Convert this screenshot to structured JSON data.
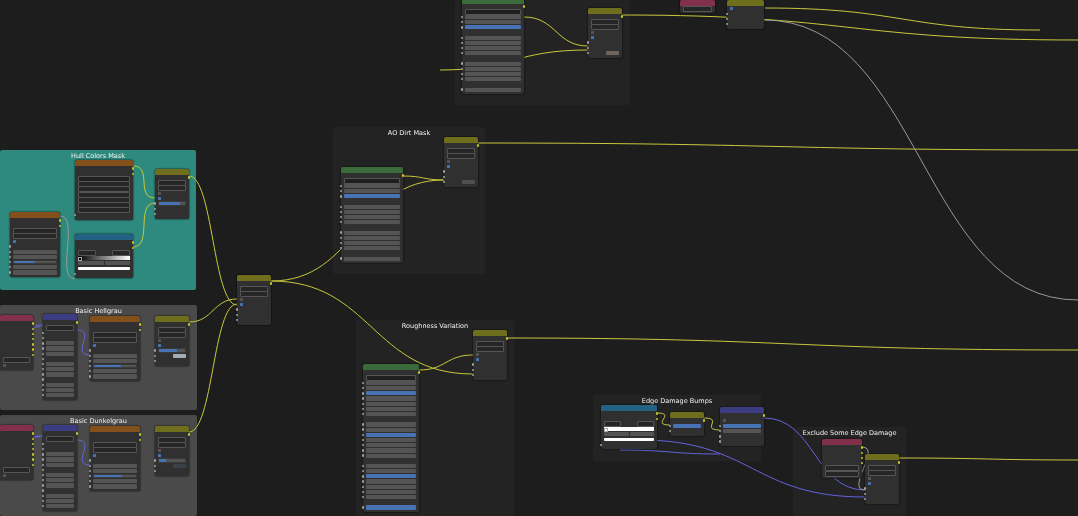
{
  "frames": [
    {
      "color": "#232323"
    },
    {
      "title": "AO Dirt Mask",
      "color": "#232323"
    },
    {
      "title": "Hull Colors Mask",
      "color": "#2e8a7e"
    },
    {
      "title": "Basic Hellgrau",
      "color": "#4a4a4a"
    },
    {
      "title": "Roughness Variation",
      "color": "#232323"
    },
    {
      "title": "Edge Damage Bumps",
      "color": "#232323"
    },
    {
      "title": "Basic Dunkelgrau",
      "color": "#4a4a4a"
    },
    {
      "title": "Exclude Some Edge Damage",
      "color": "#232323"
    }
  ],
  "nodes": [
    {
      "kind": "group",
      "rows": [
        {
          "kind": "out"
        },
        {
          "kind": "field"
        },
        {
          "kind": "value"
        },
        {
          "kind": "value"
        },
        {
          "kind": "value",
          "selected": true
        },
        {
          "kind": "sep"
        },
        {
          "kind": "value"
        },
        {
          "kind": "value"
        },
        {
          "kind": "value"
        },
        {
          "kind": "value"
        },
        {
          "kind": "sep"
        },
        {
          "kind": "value"
        },
        {
          "kind": "value"
        },
        {
          "kind": "value"
        },
        {
          "kind": "value"
        },
        {
          "kind": "sep"
        },
        {
          "kind": "value"
        }
      ]
    },
    {
      "kind": "input",
      "rows": [
        {
          "kind": "select"
        }
      ]
    },
    {
      "kind": "color",
      "rows": [
        {
          "kind": "check",
          "checked": true
        },
        {
          "kind": "in"
        },
        {
          "kind": "in"
        },
        {
          "kind": "in"
        }
      ]
    },
    {
      "kind": "color",
      "rows": [
        {
          "kind": "out"
        },
        {
          "kind": "select"
        },
        {
          "kind": "select"
        },
        {
          "kind": "check",
          "checked": false
        },
        {
          "kind": "check",
          "checked": true
        },
        {
          "kind": "in"
        },
        {
          "kind": "in"
        },
        {
          "kind": "in",
          "color": "#6e665e"
        }
      ]
    },
    {
      "kind": "color",
      "rows": [
        {
          "kind": "out"
        },
        {
          "kind": "select"
        },
        {
          "kind": "select"
        },
        {
          "kind": "check",
          "checked": false
        },
        {
          "kind": "check",
          "checked": true
        },
        {
          "kind": "in"
        },
        {
          "kind": "in"
        },
        {
          "kind": "in",
          "color": "#505050"
        }
      ]
    },
    {
      "kind": "texture",
      "rows": [
        {
          "kind": "out"
        },
        {
          "kind": "out"
        },
        {
          "kind": "field"
        },
        {
          "kind": "select"
        },
        {
          "kind": "select"
        },
        {
          "kind": "select"
        },
        {
          "kind": "select"
        },
        {
          "kind": "select"
        },
        {
          "kind": "select"
        },
        {
          "kind": "in"
        }
      ]
    },
    {
      "kind": "group",
      "rows": [
        {
          "kind": "out"
        },
        {
          "kind": "field"
        },
        {
          "kind": "value"
        },
        {
          "kind": "value"
        },
        {
          "kind": "value",
          "selected": true
        },
        {
          "kind": "sep"
        },
        {
          "kind": "value"
        },
        {
          "kind": "value"
        },
        {
          "kind": "value"
        },
        {
          "kind": "value"
        },
        {
          "kind": "sep"
        },
        {
          "kind": "value"
        },
        {
          "kind": "value"
        },
        {
          "kind": "value"
        },
        {
          "kind": "value"
        },
        {
          "kind": "sep"
        },
        {
          "kind": "value"
        }
      ]
    },
    {
      "kind": "color",
      "rows": [
        {
          "kind": "out"
        },
        {
          "kind": "select"
        },
        {
          "kind": "select"
        },
        {
          "kind": "check",
          "checked": false
        },
        {
          "kind": "check",
          "checked": true
        },
        {
          "kind": "value",
          "level": 0.8
        },
        {
          "kind": "in"
        },
        {
          "kind": "in"
        }
      ]
    },
    {
      "kind": "texture",
      "rows": [
        {
          "kind": "out"
        },
        {
          "kind": "out"
        },
        {
          "kind": "select"
        },
        {
          "kind": "select"
        },
        {
          "kind": "check",
          "checked": true
        },
        {
          "kind": "in"
        },
        {
          "kind": "value"
        },
        {
          "kind": "value"
        },
        {
          "kind": "value",
          "level": 0.5
        },
        {
          "kind": "value"
        },
        {
          "kind": "value"
        }
      ]
    },
    {
      "kind": "converter",
      "rows": [
        {
          "kind": "out"
        },
        {
          "kind": "out"
        },
        {
          "kind": "ramptools"
        },
        {
          "kind": "ramp",
          "color": "#000000"
        },
        {
          "kind": "stop"
        },
        {
          "kind": "swatch",
          "color": "#ffffff"
        },
        {
          "kind": "in"
        }
      ]
    },
    {
      "kind": "color",
      "rows": [
        {
          "kind": "out"
        },
        {
          "kind": "select"
        },
        {
          "kind": "select"
        },
        {
          "kind": "check",
          "checked": false
        },
        {
          "kind": "check",
          "checked": true
        },
        {
          "kind": "in"
        },
        {
          "kind": "in"
        },
        {
          "kind": "in"
        }
      ]
    },
    {
      "kind": "input",
      "rows": [
        {
          "kind": "out"
        },
        {
          "kind": "out"
        },
        {
          "kind": "out"
        },
        {
          "kind": "out"
        },
        {
          "kind": "out"
        },
        {
          "kind": "out"
        },
        {
          "kind": "out"
        },
        {
          "kind": "select"
        },
        {
          "kind": "check",
          "checked": false
        }
      ]
    },
    {
      "kind": "vector",
      "rows": [
        {
          "kind": "out"
        },
        {
          "kind": "select"
        },
        {
          "kind": "in"
        },
        {
          "kind": "in"
        },
        {
          "kind": "value"
        },
        {
          "kind": "value"
        },
        {
          "kind": "value"
        },
        {
          "kind": "in"
        },
        {
          "kind": "value"
        },
        {
          "kind": "value"
        },
        {
          "kind": "value"
        },
        {
          "kind": "in"
        },
        {
          "kind": "value"
        },
        {
          "kind": "value"
        },
        {
          "kind": "value"
        }
      ]
    },
    {
      "kind": "texture",
      "rows": [
        {
          "kind": "out"
        },
        {
          "kind": "out"
        },
        {
          "kind": "select"
        },
        {
          "kind": "select"
        },
        {
          "kind": "check",
          "checked": true
        },
        {
          "kind": "in"
        },
        {
          "kind": "value"
        },
        {
          "kind": "value"
        },
        {
          "kind": "value",
          "level": 0.654
        },
        {
          "kind": "value"
        },
        {
          "kind": "value"
        }
      ]
    },
    {
      "kind": "color",
      "rows": [
        {
          "kind": "out"
        },
        {
          "kind": "select"
        },
        {
          "kind": "select"
        },
        {
          "kind": "check",
          "checked": false
        },
        {
          "kind": "check",
          "checked": true
        },
        {
          "kind": "value",
          "level": 0.7
        },
        {
          "kind": "in",
          "color": "#a4acb4"
        },
        {
          "kind": "in"
        }
      ]
    },
    {
      "kind": "color",
      "rows": [
        {
          "kind": "out"
        },
        {
          "kind": "select"
        },
        {
          "kind": "select"
        },
        {
          "kind": "check",
          "checked": false
        },
        {
          "kind": "check",
          "checked": true
        },
        {
          "kind": "in"
        },
        {
          "kind": "in"
        },
        {
          "kind": "in"
        }
      ]
    },
    {
      "kind": "group",
      "rows": [
        {
          "kind": "out"
        },
        {
          "kind": "field"
        },
        {
          "kind": "value"
        },
        {
          "kind": "value"
        },
        {
          "kind": "value",
          "selected": true
        },
        {
          "kind": "value"
        },
        {
          "kind": "value"
        },
        {
          "kind": "value"
        },
        {
          "kind": "value"
        },
        {
          "kind": "sep"
        },
        {
          "kind": "value"
        },
        {
          "kind": "value"
        },
        {
          "kind": "value",
          "selected": true
        },
        {
          "kind": "value"
        },
        {
          "kind": "value"
        },
        {
          "kind": "value"
        },
        {
          "kind": "value"
        },
        {
          "kind": "sep"
        },
        {
          "kind": "value"
        },
        {
          "kind": "value"
        },
        {
          "kind": "value",
          "selected": true
        },
        {
          "kind": "value"
        },
        {
          "kind": "value"
        },
        {
          "kind": "value"
        },
        {
          "kind": "value"
        },
        {
          "kind": "sep"
        },
        {
          "kind": "value",
          "selected": true
        }
      ]
    },
    {
      "kind": "converter",
      "rows": [
        {
          "kind": "out"
        },
        {
          "kind": "out"
        },
        {
          "kind": "ramptools"
        },
        {
          "kind": "ramp",
          "color": "#ffffff"
        },
        {
          "kind": "stop"
        },
        {
          "kind": "swatch",
          "color": "#ffffff"
        },
        {
          "kind": "in"
        }
      ]
    },
    {
      "kind": "vector",
      "rows": [
        {
          "kind": "out"
        },
        {
          "kind": "check",
          "checked": false
        },
        {
          "kind": "value",
          "level": 1
        },
        {
          "kind": "value"
        },
        {
          "kind": "in"
        },
        {
          "kind": "in"
        }
      ]
    },
    {
      "kind": "color",
      "rows": [
        {
          "kind": "out"
        },
        {
          "kind": "value",
          "level": 1
        },
        {
          "kind": "in"
        }
      ]
    },
    {
      "kind": "input",
      "rows": [
        {
          "kind": "out"
        },
        {
          "kind": "out"
        },
        {
          "kind": "out"
        },
        {
          "kind": "out"
        },
        {
          "kind": "out"
        },
        {
          "kind": "out"
        },
        {
          "kind": "out"
        },
        {
          "kind": "select"
        },
        {
          "kind": "check",
          "checked": false
        }
      ]
    },
    {
      "kind": "vector",
      "rows": [
        {
          "kind": "out"
        },
        {
          "kind": "select"
        },
        {
          "kind": "in"
        },
        {
          "kind": "in"
        },
        {
          "kind": "value"
        },
        {
          "kind": "value"
        },
        {
          "kind": "value"
        },
        {
          "kind": "in"
        },
        {
          "kind": "value"
        },
        {
          "kind": "value"
        },
        {
          "kind": "value"
        },
        {
          "kind": "in"
        },
        {
          "kind": "value"
        },
        {
          "kind": "value"
        },
        {
          "kind": "value"
        }
      ]
    },
    {
      "kind": "texture",
      "rows": [
        {
          "kind": "out"
        },
        {
          "kind": "out"
        },
        {
          "kind": "select"
        },
        {
          "kind": "select"
        },
        {
          "kind": "check",
          "checked": true
        },
        {
          "kind": "in"
        },
        {
          "kind": "value"
        },
        {
          "kind": "value"
        },
        {
          "kind": "value",
          "level": 0.676
        },
        {
          "kind": "value"
        },
        {
          "kind": "value"
        }
      ]
    },
    {
      "kind": "color",
      "rows": [
        {
          "kind": "out"
        },
        {
          "kind": "select"
        },
        {
          "kind": "select"
        },
        {
          "kind": "check",
          "checked": false
        },
        {
          "kind": "check",
          "checked": true
        },
        {
          "kind": "value",
          "level": 0.25
        },
        {
          "kind": "in",
          "color": "#3c4048"
        },
        {
          "kind": "in"
        }
      ]
    },
    {
      "kind": "input",
      "rows": [
        {
          "kind": "out"
        },
        {
          "kind": "out"
        },
        {
          "kind": "out"
        },
        {
          "kind": "out"
        },
        {
          "kind": "select"
        },
        {
          "kind": "select"
        }
      ]
    },
    {
      "kind": "color",
      "rows": [
        {
          "kind": "out"
        },
        {
          "kind": "select"
        },
        {
          "kind": "select"
        },
        {
          "kind": "check",
          "checked": false
        },
        {
          "kind": "check",
          "checked": true
        },
        {
          "kind": "in"
        },
        {
          "kind": "in"
        },
        {
          "kind": "in"
        }
      ]
    }
  ]
}
